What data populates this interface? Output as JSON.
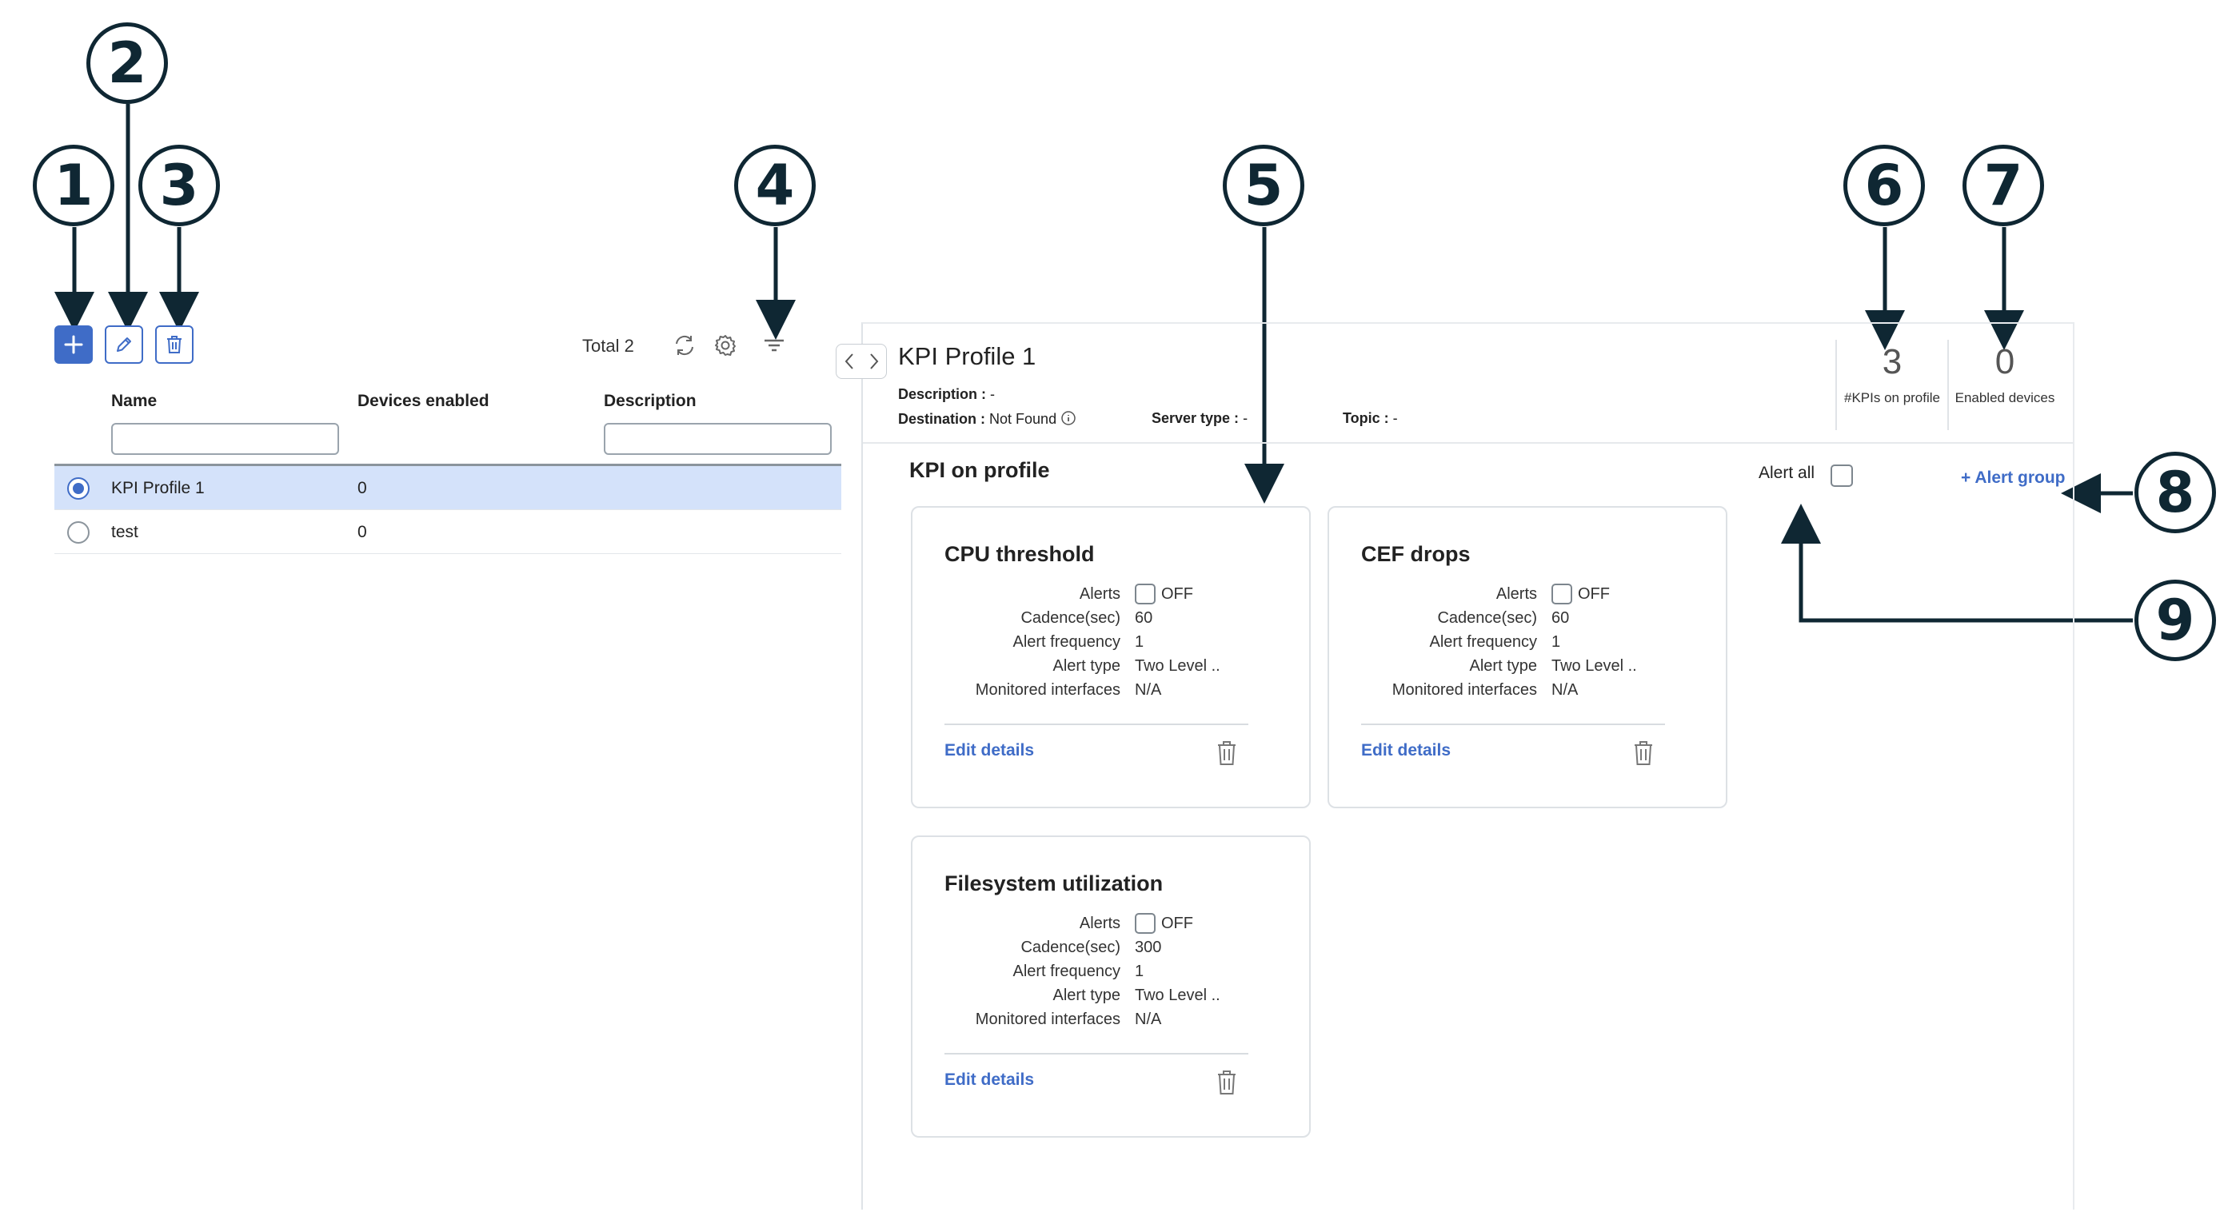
{
  "callouts": [
    "1",
    "2",
    "3",
    "4",
    "5",
    "6",
    "7",
    "8",
    "9"
  ],
  "toolbar": {
    "add_icon": "plus-icon",
    "edit_icon": "pencil-icon",
    "delete_icon": "trash-icon",
    "total_text": "Total 2",
    "refresh_icon": "refresh-icon",
    "settings_icon": "gear-icon",
    "filter_icon": "filter-icon"
  },
  "table": {
    "headers": [
      "Name",
      "Devices enabled",
      "Description"
    ],
    "rows": [
      {
        "name": "KPI Profile 1",
        "devices": "0",
        "description": "",
        "selected": true
      },
      {
        "name": "test",
        "devices": "0",
        "description": "",
        "selected": false
      }
    ]
  },
  "panel": {
    "title": "KPI Profile 1",
    "description_label": "Description :",
    "description_value": "-",
    "destination_label": "Destination :",
    "destination_value": "Not Found",
    "server_type_label": "Server type :",
    "server_type_value": "-",
    "topic_label": "Topic :",
    "topic_value": "-",
    "kpis_count": "3",
    "kpis_label": "#KPIs on profile",
    "devices_count": "0",
    "devices_label": "Enabled devices",
    "section_title": "KPI on profile",
    "alert_all_label": "Alert all",
    "alert_group_label": "+ Alert group"
  },
  "cards": [
    {
      "title": "CPU threshold",
      "alerts_label": "Alerts",
      "alerts_value": "OFF",
      "cadence_label": "Cadence(sec)",
      "cadence_value": "60",
      "freq_label": "Alert frequency",
      "freq_value": "1",
      "type_label": "Alert type",
      "type_value": "Two Level ..",
      "iface_label": "Monitored interfaces",
      "iface_value": "N/A",
      "edit_label": "Edit details"
    },
    {
      "title": "CEF drops",
      "alerts_label": "Alerts",
      "alerts_value": "OFF",
      "cadence_label": "Cadence(sec)",
      "cadence_value": "60",
      "freq_label": "Alert frequency",
      "freq_value": "1",
      "type_label": "Alert type",
      "type_value": "Two Level ..",
      "iface_label": "Monitored interfaces",
      "iface_value": "N/A",
      "edit_label": "Edit details"
    },
    {
      "title": "Filesystem utilization",
      "alerts_label": "Alerts",
      "alerts_value": "OFF",
      "cadence_label": "Cadence(sec)",
      "cadence_value": "300",
      "freq_label": "Alert frequency",
      "freq_value": "1",
      "type_label": "Alert type",
      "type_value": "Two Level ..",
      "iface_label": "Monitored interfaces",
      "iface_value": "N/A",
      "edit_label": "Edit details"
    }
  ],
  "colors": {
    "accent": "#3f6cc7",
    "selected_row": "#d4e2fa",
    "callout": "#0f2733"
  }
}
